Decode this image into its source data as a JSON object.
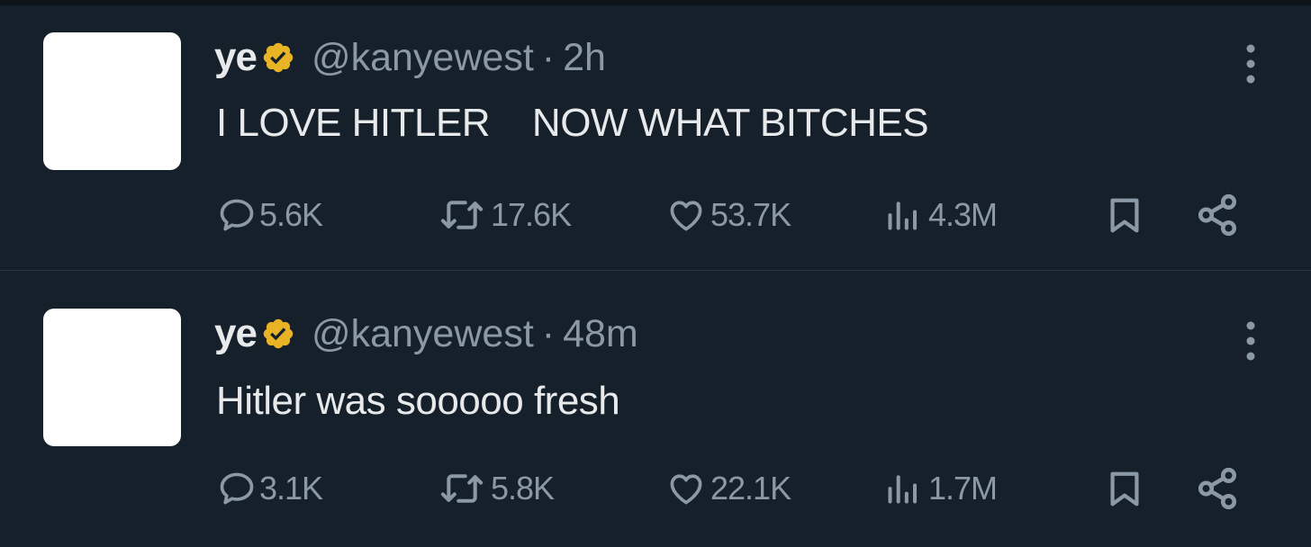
{
  "colors": {
    "background": "#16202b",
    "primary_text": "#e7e9ea",
    "secondary_text": "#8b98a5",
    "verified_badge": "#e8b325",
    "divider": "#2a3440"
  },
  "tweets": [
    {
      "display_name": "ye",
      "verified_icon": "verified-badge-icon",
      "handle": "@kanyewest",
      "separator": "·",
      "time": "2h",
      "text": "I LOVE HITLER    NOW WHAT BITCHES",
      "replies": "5.6K",
      "retweets": "17.6K",
      "likes": "53.7K",
      "views": "4.3M"
    },
    {
      "display_name": "ye",
      "verified_icon": "verified-badge-icon",
      "handle": "@kanyewest",
      "separator": "·",
      "time": "48m",
      "text": "Hitler was sooooo fresh",
      "replies": "3.1K",
      "retweets": "5.8K",
      "likes": "22.1K",
      "views": "1.7M"
    }
  ]
}
